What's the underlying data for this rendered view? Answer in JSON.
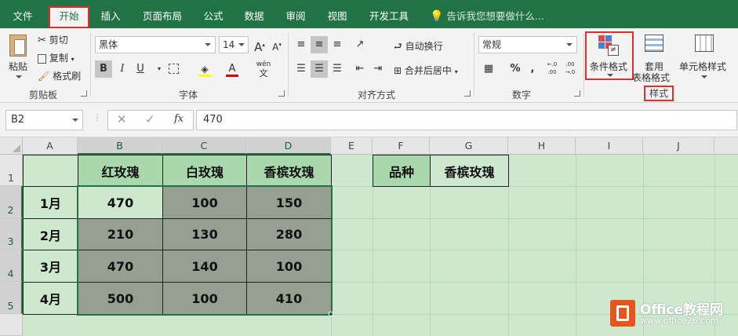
{
  "tabs": [
    {
      "label": "文件",
      "left": 0
    },
    {
      "label": "开始",
      "active": true
    },
    {
      "label": "插入"
    },
    {
      "label": "页面布局"
    },
    {
      "label": "公式"
    },
    {
      "label": "数据"
    },
    {
      "label": "审阅"
    },
    {
      "label": "视图"
    },
    {
      "label": "开发工具"
    }
  ],
  "tell_me": "告诉我您想要做什么...",
  "clipboard": {
    "paste": "粘贴",
    "cut": "剪切",
    "copy": "复制",
    "format_painter": "格式刷",
    "group": "剪贴板"
  },
  "font": {
    "family": "黑体",
    "size": "14",
    "bold": "B",
    "italic": "I",
    "underline": "U",
    "group": "字体",
    "aa_big": "A",
    "aa_small": "A",
    "wen": "wén",
    "wen_char": "文"
  },
  "alignment": {
    "wrap": "自动换行",
    "merge": "合并后居中",
    "group": "对齐方式"
  },
  "number": {
    "format": "常规",
    "percent": "%",
    "comma": ",",
    "inc": "←.0 .00",
    "dec": ".00 →.0",
    "group": "数字"
  },
  "styles": {
    "conditional": "条件格式",
    "table_1": "套用",
    "table_2": "表格格式",
    "cell_styles": "单元格样式",
    "group": "样式"
  },
  "formula_bar": {
    "name_box": "B2",
    "fx": "fx",
    "value": "470"
  },
  "columns": [
    "A",
    "B",
    "C",
    "D",
    "E",
    "F",
    "G",
    "H",
    "I",
    "J"
  ],
  "rows": [
    "1",
    "2",
    "3",
    "4",
    "5"
  ],
  "table": {
    "headers": [
      "红玫瑰",
      "白玫瑰",
      "香槟玫瑰"
    ],
    "months": [
      "1月",
      "2月",
      "3月",
      "4月"
    ],
    "values": [
      [
        "470",
        "100",
        "150"
      ],
      [
        "210",
        "130",
        "280"
      ],
      [
        "470",
        "140",
        "100"
      ],
      [
        "500",
        "100",
        "410"
      ]
    ]
  },
  "lookup": {
    "label": "品种",
    "value": "香槟玫瑰"
  },
  "watermark": {
    "brand": "Office教程网",
    "url": "www.office26.com"
  },
  "colors": {
    "ribbon_green": "#217346",
    "grid_bg": "#cde8cf",
    "header_fill": "#a9d8ac",
    "value_fill": "#969f92",
    "highlight_red": "#e0302b"
  }
}
